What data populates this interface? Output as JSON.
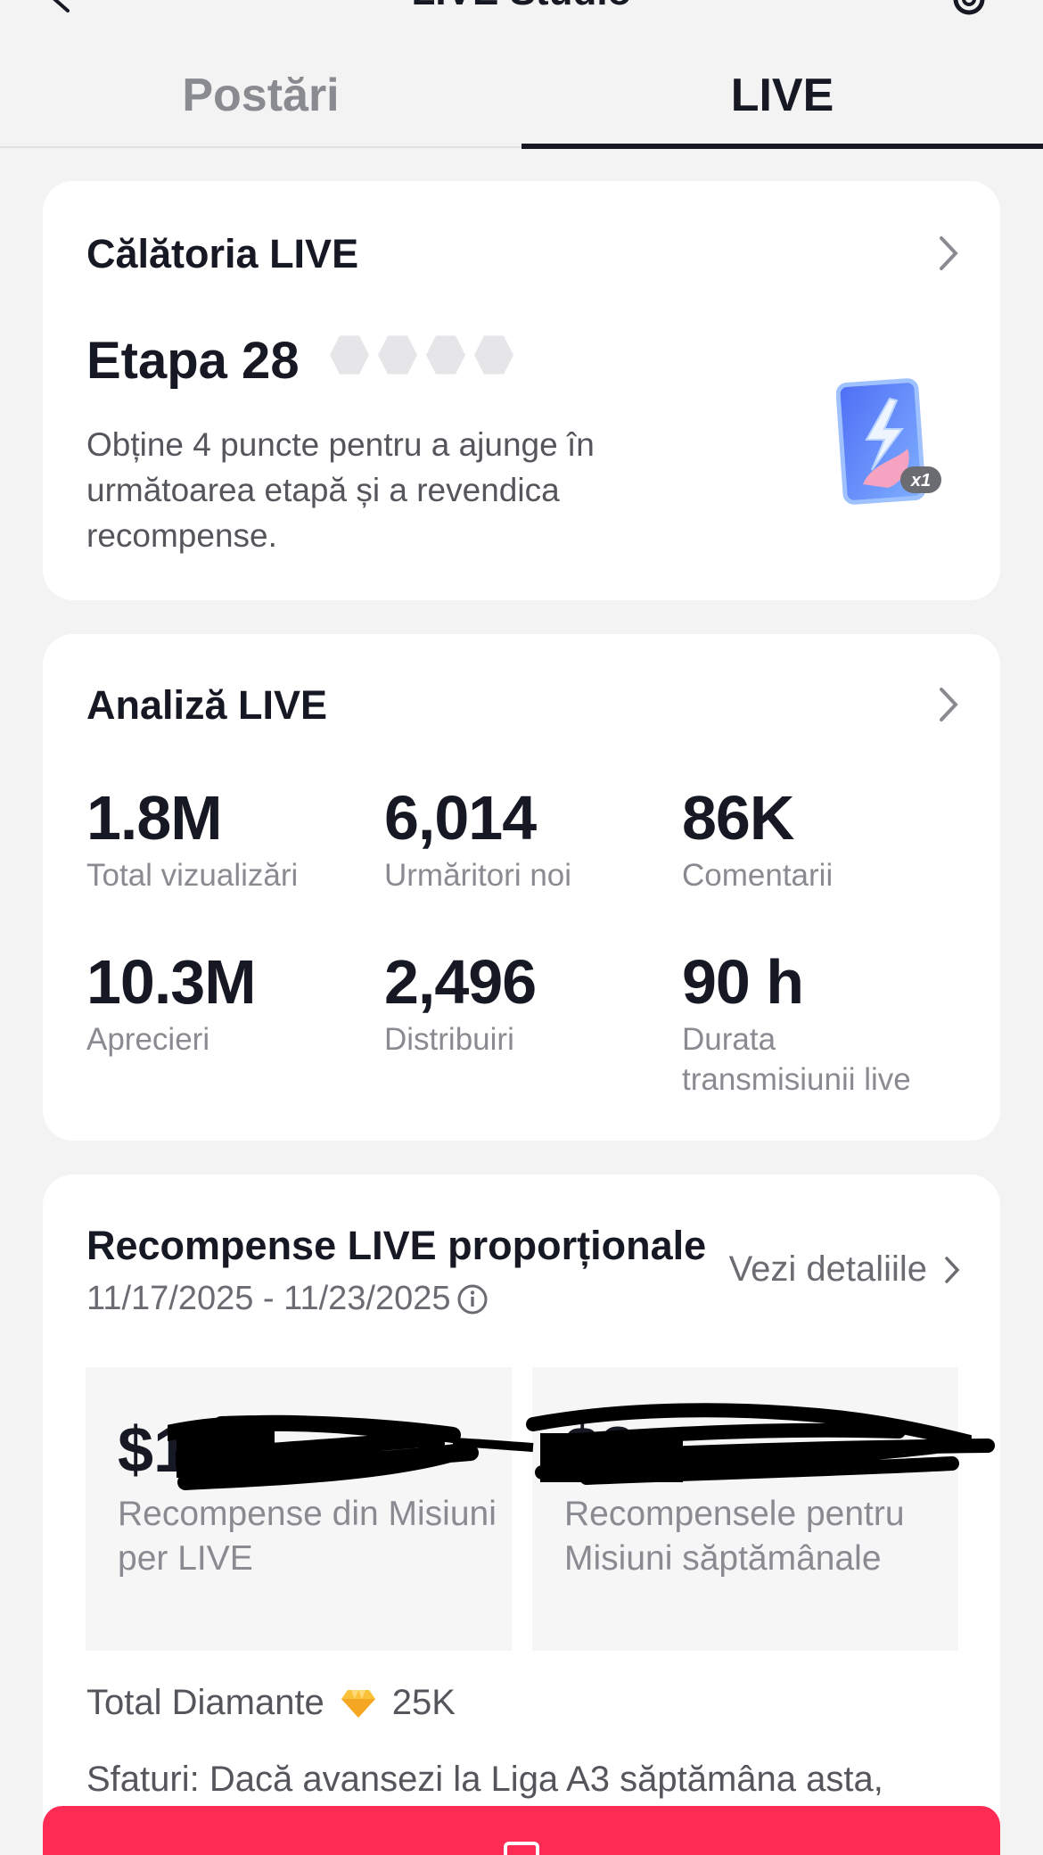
{
  "header": {
    "title": "LIVE Studio"
  },
  "tabs": [
    {
      "label": "Postări",
      "active": false
    },
    {
      "label": "LIVE",
      "active": true
    }
  ],
  "journey": {
    "title": "Călătoria LIVE",
    "stage": "Etapa 28",
    "points_total": 4,
    "points_earned": 0,
    "description": "Obține 4 puncte pentru a ajunge în următoarea etapă și a revendica recompense.",
    "reward_badge": "x1"
  },
  "analytics": {
    "title": "Analiză LIVE",
    "stats": [
      {
        "value": "1.8M",
        "label": "Total vizualizări"
      },
      {
        "value": "6,014",
        "label": "Urmăritori noi"
      },
      {
        "value": "86K",
        "label": "Comentarii"
      },
      {
        "value": "10.3M",
        "label": "Aprecieri"
      },
      {
        "value": "2,496",
        "label": "Distribuiri"
      },
      {
        "value": "90 h",
        "label": "Durata transmisiunii live"
      }
    ]
  },
  "rewards": {
    "title": "Recompense LIVE proporționale",
    "dates": "11/17/2025 - 11/23/2025",
    "details_link": "Vezi detaliile",
    "boxes": [
      {
        "amount": "$1",
        "label": "Recompense din Misiuni per LIVE"
      },
      {
        "amount": "$2",
        "label": "Recompensele pentru Misiuni săptămânale"
      }
    ],
    "diamonds_label": "Total Diamante",
    "diamonds_value": "25K",
    "tips": "Sfaturi: Dacă avansezi la Liga A3 săptămâna asta,"
  },
  "colors": {
    "accent": "#fe2c55",
    "text": "#161823",
    "muted": "#8a8b91",
    "background": "#f3f3f4"
  }
}
